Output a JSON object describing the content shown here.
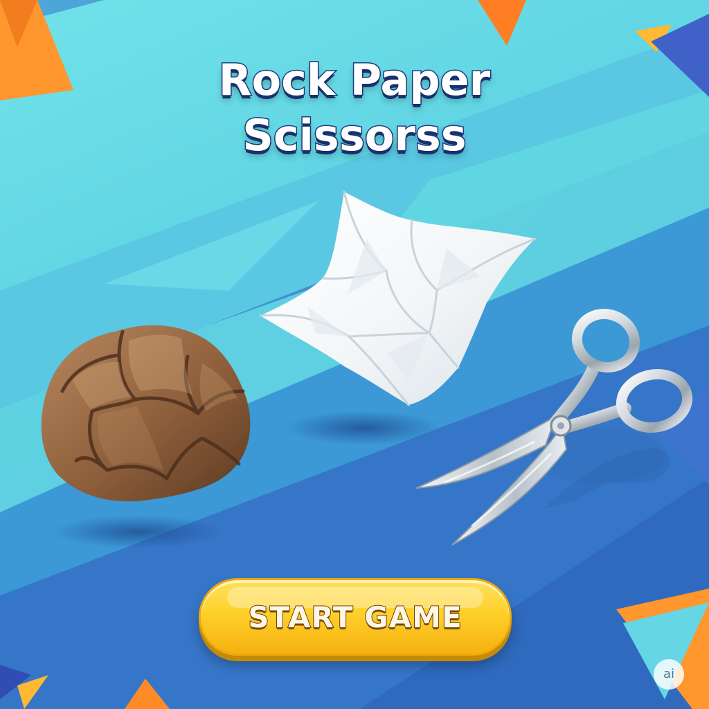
{
  "game": {
    "title_line_1": "Rock Paper",
    "title_line_2": "Scissorss",
    "start_button_label": "START GAME",
    "badge_label": "ai"
  },
  "items": {
    "rock": "rock-illustration",
    "paper": "paper-illustration",
    "scissors": "scissors-illustration"
  },
  "colors": {
    "background_dark": "#3f88d0",
    "background_light": "#64dbe0",
    "accent_orange": "#ff962e",
    "accent_yellow": "#ffd02a",
    "title_outline": "#1f3c86"
  }
}
